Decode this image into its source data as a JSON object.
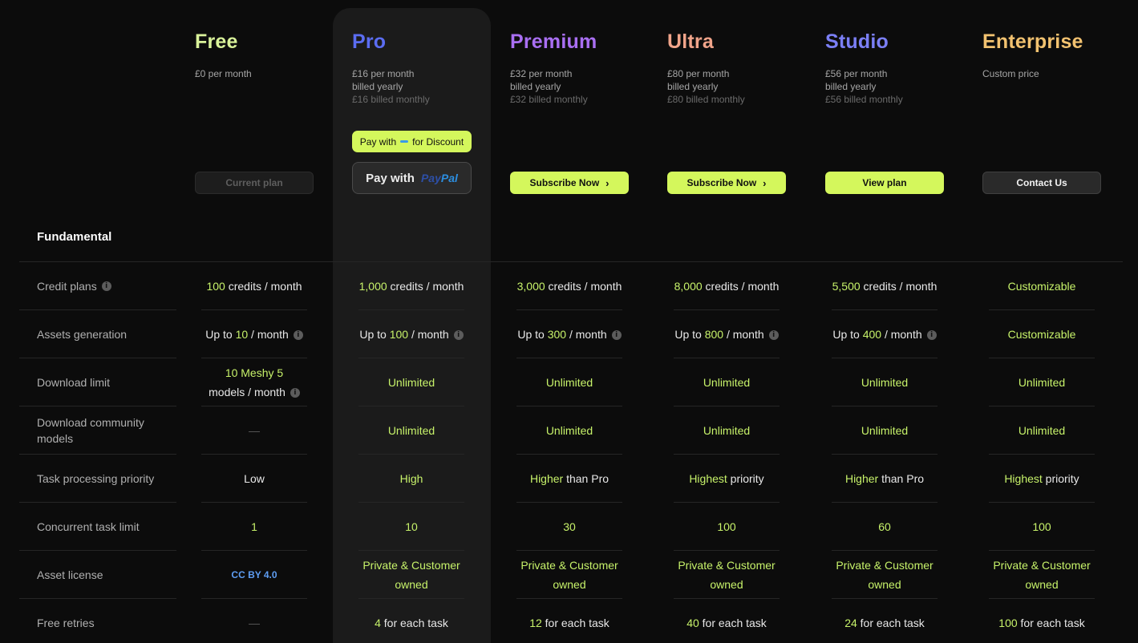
{
  "colors": {
    "background": "#0c0c0c",
    "accent": "#d4f75c",
    "value_highlight": "#c7f26a"
  },
  "plans": [
    {
      "name": "Free",
      "color": "#d9f29a",
      "price_line1": "£0 per month",
      "button": {
        "label": "Current plan",
        "style": "disabled"
      }
    },
    {
      "name": "Pro",
      "color": "#5b6df2",
      "price_line1": "£16 per month",
      "price_line2": "billed yearly",
      "price_line3": "£16 billed monthly",
      "discount_badge": {
        "prefix": "Pay with",
        "suffix": "for Discount"
      },
      "paypal_button": {
        "label": "Pay with",
        "brand_a": "Pay",
        "brand_b": "Pal"
      }
    },
    {
      "name": "Premium",
      "color": "#a96ff2",
      "price_line1": "£32 per month",
      "price_line2": "billed yearly",
      "price_line3": "£32 billed monthly",
      "button": {
        "label": "Subscribe Now",
        "style": "lime",
        "chevron": "›"
      }
    },
    {
      "name": "Ultra",
      "color": "#f0a48a",
      "price_line1": "£80 per month",
      "price_line2": "billed yearly",
      "price_line3": "£80 billed monthly",
      "button": {
        "label": "Subscribe Now",
        "style": "lime",
        "chevron": "›"
      }
    },
    {
      "name": "Studio",
      "color": "#7b7ff5",
      "price_line1": "£56 per month",
      "price_line2": "billed yearly",
      "price_line3": "£56 billed monthly",
      "button": {
        "label": "View plan",
        "style": "lime"
      }
    },
    {
      "name": "Enterprise",
      "color": "#f2c270",
      "price_line1": "Custom price",
      "button": {
        "label": "Contact Us",
        "style": "dark"
      }
    }
  ],
  "section_title": "Fundamental",
  "info_glyph": "i",
  "rows": [
    {
      "label": "Credit plans",
      "info": true,
      "cells": [
        {
          "acc": "100",
          "text": " credits / month"
        },
        {
          "acc": "1,000",
          "text": " credits / month"
        },
        {
          "acc": "3,000",
          "text": " credits / month"
        },
        {
          "acc": "8,000",
          "text": " credits / month"
        },
        {
          "acc": "5,500",
          "text": " credits / month"
        },
        {
          "lime": "Customizable"
        }
      ]
    },
    {
      "label": "Assets generation",
      "cells": [
        {
          "pre": "Up to ",
          "acc": "10",
          "text": " / month",
          "info": true
        },
        {
          "pre": "Up to ",
          "acc": "100",
          "text": " / month",
          "info": true
        },
        {
          "pre": "Up to ",
          "acc": "300",
          "text": " / month",
          "info": true
        },
        {
          "pre": "Up to ",
          "acc": "800",
          "text": " / month",
          "info": true
        },
        {
          "pre": "Up to ",
          "acc": "400",
          "text": " / month",
          "info": true
        },
        {
          "lime": "Customizable"
        }
      ]
    },
    {
      "label": "Download limit",
      "cells": [
        {
          "acc": "10 Meshy 5",
          "line2": "models / month",
          "info": true
        },
        {
          "lime": "Unlimited"
        },
        {
          "lime": "Unlimited"
        },
        {
          "lime": "Unlimited"
        },
        {
          "lime": "Unlimited"
        },
        {
          "lime": "Unlimited"
        }
      ]
    },
    {
      "label": "Download community models",
      "cells": [
        {
          "dash": "—"
        },
        {
          "lime": "Unlimited"
        },
        {
          "lime": "Unlimited"
        },
        {
          "lime": "Unlimited"
        },
        {
          "lime": "Unlimited"
        },
        {
          "lime": "Unlimited"
        }
      ]
    },
    {
      "label": "Task processing priority",
      "cells": [
        {
          "text": "Low"
        },
        {
          "lime": "High"
        },
        {
          "acc": "Higher",
          "text": " than Pro"
        },
        {
          "acc": "Highest",
          "text": " priority"
        },
        {
          "acc": "Higher",
          "text": " than Pro"
        },
        {
          "acc": "Highest",
          "text": " priority"
        }
      ]
    },
    {
      "label": "Concurrent task limit",
      "cells": [
        {
          "lime": "1"
        },
        {
          "lime": "10"
        },
        {
          "lime": "30"
        },
        {
          "lime": "100"
        },
        {
          "lime": "60"
        },
        {
          "lime": "100"
        }
      ]
    },
    {
      "label": "Asset license",
      "cells": [
        {
          "blue": "CC BY 4.0"
        },
        {
          "lime": "Private & Customer owned"
        },
        {
          "lime": "Private & Customer owned"
        },
        {
          "lime": "Private & Customer owned"
        },
        {
          "lime": "Private & Customer owned"
        },
        {
          "lime": "Private & Customer owned"
        }
      ]
    },
    {
      "label": "Free retries",
      "cells": [
        {
          "dash": "—"
        },
        {
          "acc": "4",
          "text": " for each task"
        },
        {
          "acc": "12",
          "text": " for each task"
        },
        {
          "acc": "40",
          "text": " for each task"
        },
        {
          "acc": "24",
          "text": " for each task"
        },
        {
          "acc": "100",
          "text": " for each task"
        }
      ]
    }
  ]
}
